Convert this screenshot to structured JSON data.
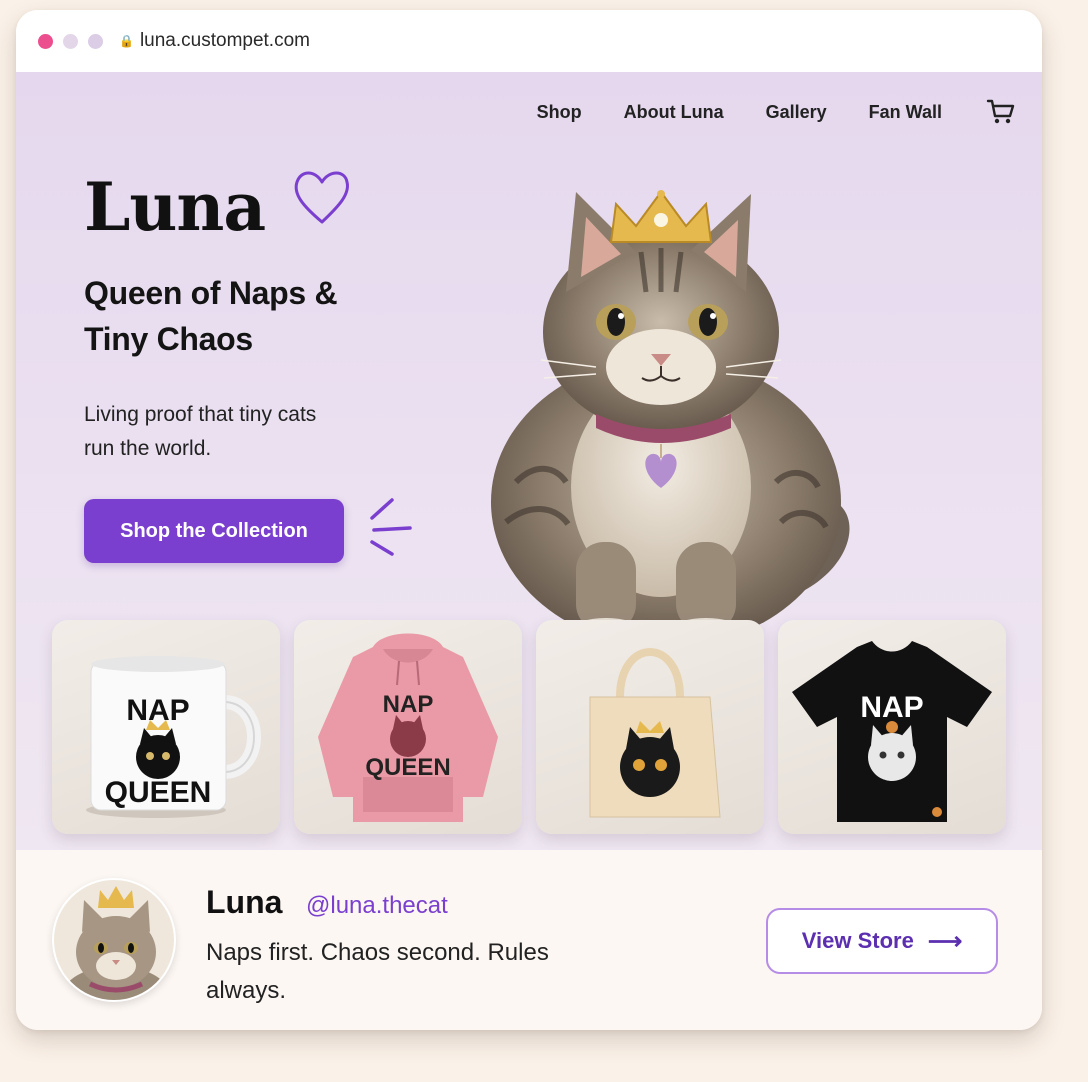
{
  "browser": {
    "url": "luna.custompet.com",
    "dot_colors": [
      "#ec4f8e",
      "#e3d6e8",
      "#dccde6"
    ]
  },
  "nav": {
    "items": [
      "Shop",
      "About Luna",
      "Gallery",
      "Fan Wall"
    ],
    "cart_icon": "cart-icon"
  },
  "hero": {
    "title": "Luna",
    "title_icon": "heart-icon",
    "subtitle": "Queen of Naps & Tiny Chaos",
    "tagline": "Living proof that tiny cats run the world.",
    "cta_label": "Shop the Collection"
  },
  "products": [
    {
      "name": "mug",
      "line1": "NAP",
      "line2": "QUEEN"
    },
    {
      "name": "hoodie",
      "line1": "NAP",
      "line2": "QUEEN"
    },
    {
      "name": "tote-bag"
    },
    {
      "name": "t-shirt",
      "line1": "NAP"
    }
  ],
  "profile": {
    "name": "Luna",
    "handle": "@luna.thecat",
    "bio": "Naps first. Chaos second. Rules always.",
    "button_label": "View Store",
    "button_icon": "arrow-right-icon"
  },
  "colors": {
    "accent": "#7a3fcf",
    "hero_bg": "#e8dcef",
    "page_bg": "#faf1e8"
  }
}
